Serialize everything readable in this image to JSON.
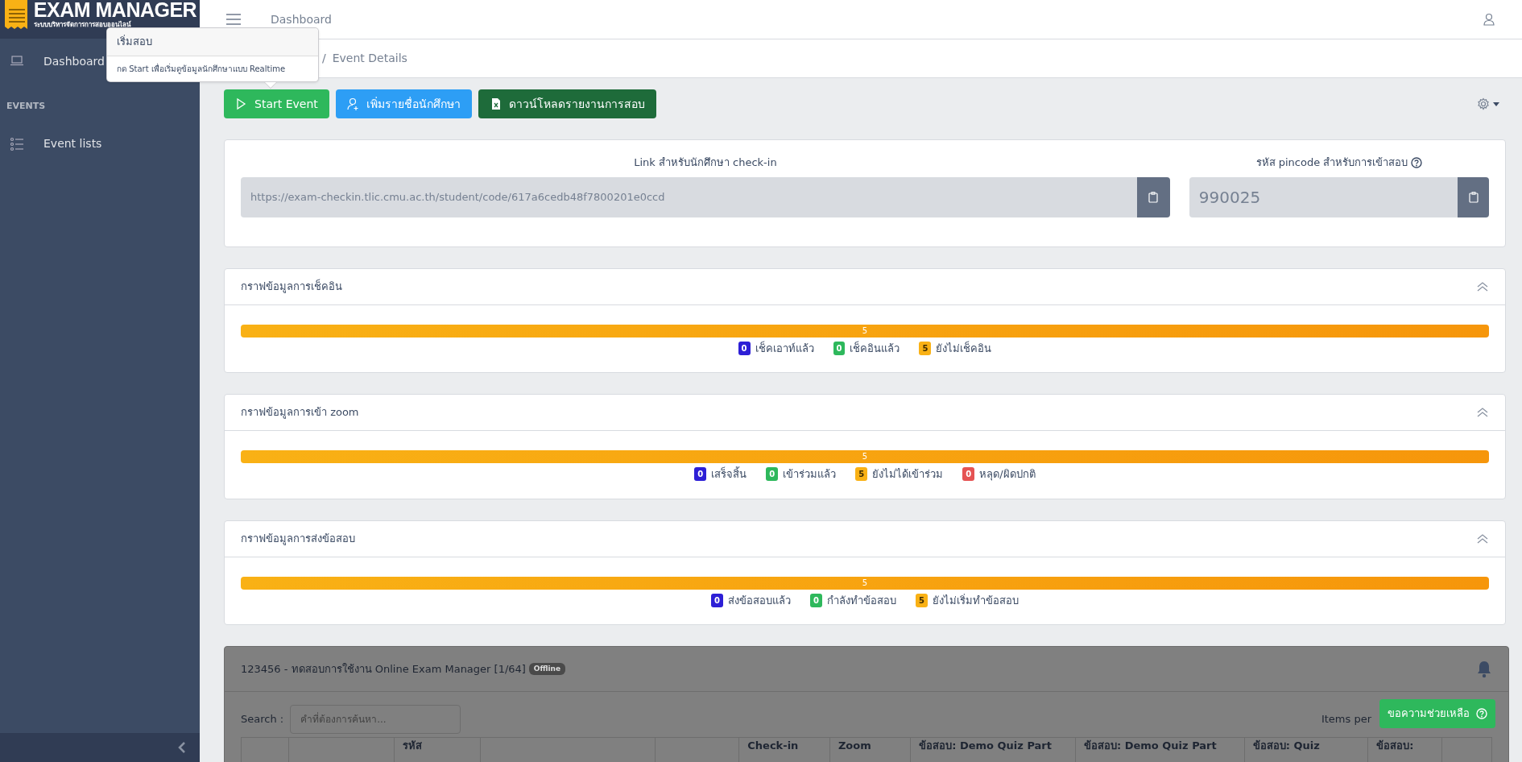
{
  "sidebar": {
    "logo": {
      "title": "EXAM MANAGER",
      "subtitle": "ระบบบริหารจัดการการสอบออนไลน์"
    },
    "items": [
      {
        "kind": "link",
        "label": "Dashboard",
        "selected": false
      },
      {
        "kind": "heading",
        "label": "EVENTS"
      },
      {
        "kind": "link",
        "label": "Event lists",
        "selected": false
      }
    ]
  },
  "topbar": {
    "title": "Dashboard"
  },
  "breadcrumb": {
    "separator": "/",
    "current": "Event Details"
  },
  "tooltip": {
    "title": "เริ่มสอบ",
    "body": "กด Start เพื่อเริ่มดูข้อมูลนักศึกษาแบบ Realtime"
  },
  "actions": [
    {
      "kind": "start",
      "label": "Start Event"
    },
    {
      "kind": "add",
      "label": "เพิ่มรายชื่อนักศึกษา"
    },
    {
      "kind": "excel",
      "label": "ดาวน์โหลดรายงานการสอบ"
    }
  ],
  "link_card": {
    "link_label": "Link สำหรับนักศึกษา check-in",
    "link_value": "https://exam-checkin.tlic.cmu.ac.th/student/code/617a6cedb48f7800201e0ccd",
    "pin_label": "รหัส pincode สำหรับการเข้าสอบ",
    "pin_value": "990025"
  },
  "charts": [
    {
      "title": "กราฟข้อมูลการเช็คอิน",
      "expanded": true,
      "bar": {
        "level": 1,
        "label": "5"
      },
      "legend": [
        {
          "count": "0",
          "label": "เช็คเอาท์แล้ว",
          "color": "#2d1fd6"
        },
        {
          "count": "0",
          "label": "เช็คอินแล้ว",
          "color": "#2eb85c"
        },
        {
          "count": "5",
          "label": "ยังไม่เช็คอิน",
          "color": "#f9b115"
        }
      ]
    },
    {
      "title": "กราฟข้อมูลการเข้า zoom",
      "expanded": true,
      "bar": {
        "level": 1,
        "label": "5"
      },
      "legend": [
        {
          "count": "0",
          "label": "เสร็จสิ้น",
          "color": "#2d1fd6"
        },
        {
          "count": "0",
          "label": "เข้าร่วมแล้ว",
          "color": "#2eb85c"
        },
        {
          "count": "5",
          "label": "ยังไม่ได้เข้าร่วม",
          "color": "#f9b115"
        },
        {
          "count": "0",
          "label": "หลุด/ผิดปกติ",
          "color": "#e55353"
        }
      ]
    },
    {
      "title": "กราฟข้อมูลการส่งข้อสอบ",
      "expanded": true,
      "bar": {
        "level": 1,
        "label": "5"
      },
      "legend": [
        {
          "count": "0",
          "label": "ส่งข้อสอบแล้ว",
          "color": "#2d1fd6"
        },
        {
          "count": "0",
          "label": "กำลังทำข้อสอบ",
          "color": "#2eb85c"
        },
        {
          "count": "5",
          "label": "ยังไม่เริ่มทำข้อสอบ",
          "color": "#f9b115"
        }
      ]
    }
  ],
  "table": {
    "title": "123456 - ทดสอบการใช้งาน Online Exam Manager [1/64]",
    "status": "Offline",
    "loading": true,
    "search_label": "Search :",
    "search_placeholder": "คำที่ต้องการค้นหา...",
    "items_label": "Items per",
    "columns": [
      {},
      {},
      {
        "label": "รหัส"
      },
      {},
      {},
      {
        "label": "Check-in"
      },
      {
        "label": "Zoom"
      },
      {
        "label": "ข้อสอบ: Demo Quiz Part"
      },
      {
        "label": "ข้อสอบ: Demo Quiz Part"
      },
      {
        "label": "ข้อสอบ: Quiz"
      },
      {
        "label": "ข้อสอบ:"
      },
      {}
    ]
  },
  "help_button": {
    "label": "ขอความช่วยเหลือ"
  }
}
